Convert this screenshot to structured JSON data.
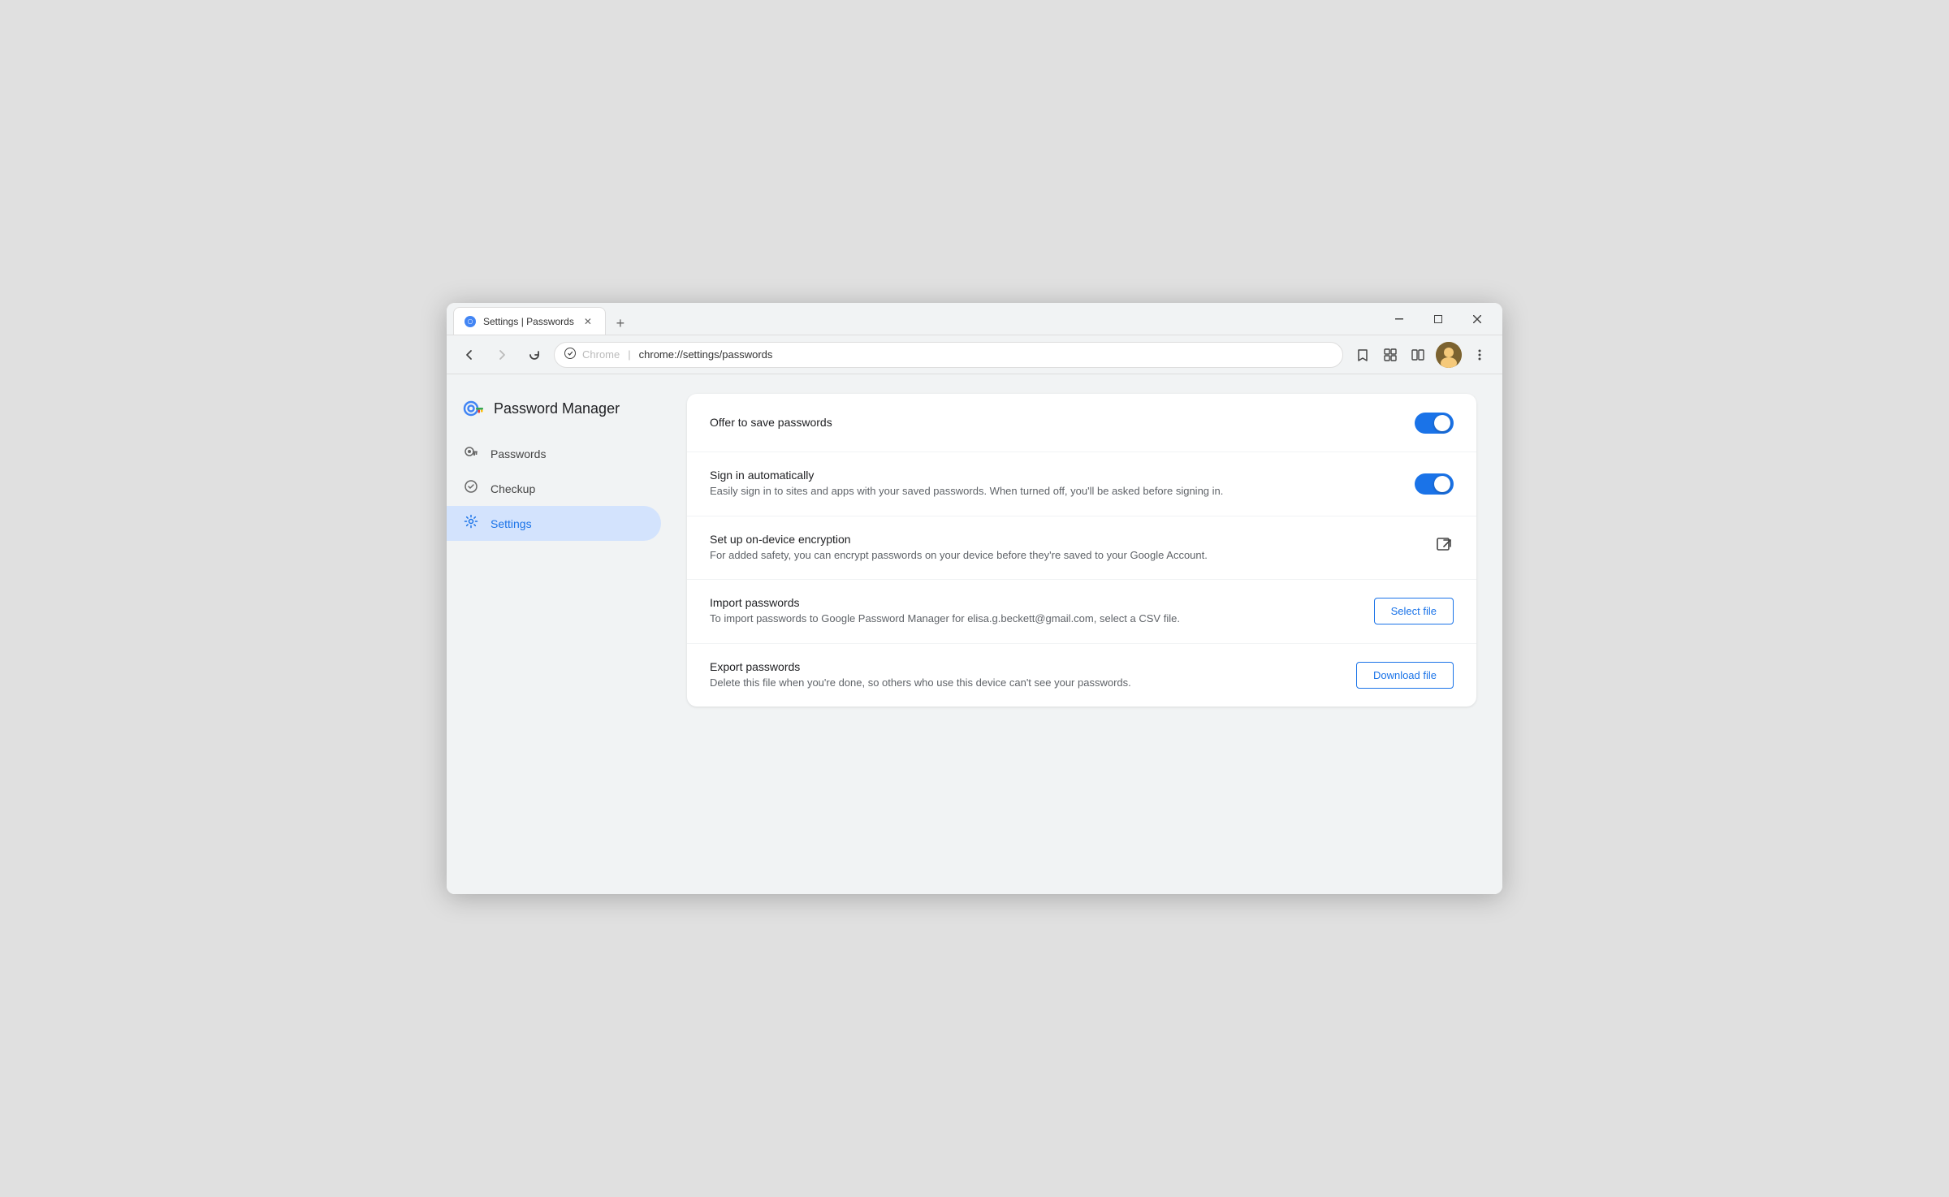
{
  "browser": {
    "tab_title": "Settings | Passwords",
    "tab_favicon": "⚙",
    "url_security_label": "Chrome",
    "url": "chrome://settings/passwords",
    "new_tab_symbol": "+",
    "minimize_symbol": "—",
    "maximize_symbol": "□",
    "close_symbol": "✕",
    "chevron_down": "⌄"
  },
  "nav": {
    "back_symbol": "←",
    "forward_symbol": "→",
    "refresh_symbol": "↻",
    "star_symbol": "☆",
    "extensions_symbol": "⚡",
    "split_symbol": "⊡",
    "menu_symbol": "⋮"
  },
  "sidebar": {
    "brand_title": "Password Manager",
    "items": [
      {
        "id": "passwords",
        "label": "Passwords",
        "icon": "🔑"
      },
      {
        "id": "checkup",
        "label": "Checkup",
        "icon": "🛡"
      },
      {
        "id": "settings",
        "label": "Settings",
        "icon": "⚙",
        "active": true
      }
    ]
  },
  "settings": {
    "rows": [
      {
        "id": "offer-save",
        "title": "Offer to save passwords",
        "desc": "",
        "control": "toggle",
        "toggle_on": true
      },
      {
        "id": "sign-in-auto",
        "title": "Sign in automatically",
        "desc": "Easily sign in to sites and apps with your saved passwords. When turned off, you'll be asked before signing in.",
        "control": "toggle",
        "toggle_on": true
      },
      {
        "id": "on-device-encryption",
        "title": "Set up on-device encryption",
        "desc": "For added safety, you can encrypt passwords on your device before they're saved to your Google Account.",
        "control": "external-link"
      },
      {
        "id": "import-passwords",
        "title": "Import passwords",
        "desc": "To import passwords to Google Password Manager for elisa.g.beckett@gmail.com, select a CSV file.",
        "control": "button",
        "button_label": "Select file"
      },
      {
        "id": "export-passwords",
        "title": "Export passwords",
        "desc": "Delete this file when you're done, so others who use this device can't see your passwords.",
        "control": "button",
        "button_label": "Download file"
      }
    ]
  },
  "colors": {
    "accent": "#1a73e8",
    "toggle_on": "#1a73e8",
    "active_nav_bg": "#d3e3fd",
    "active_nav_text": "#1a73e8"
  }
}
